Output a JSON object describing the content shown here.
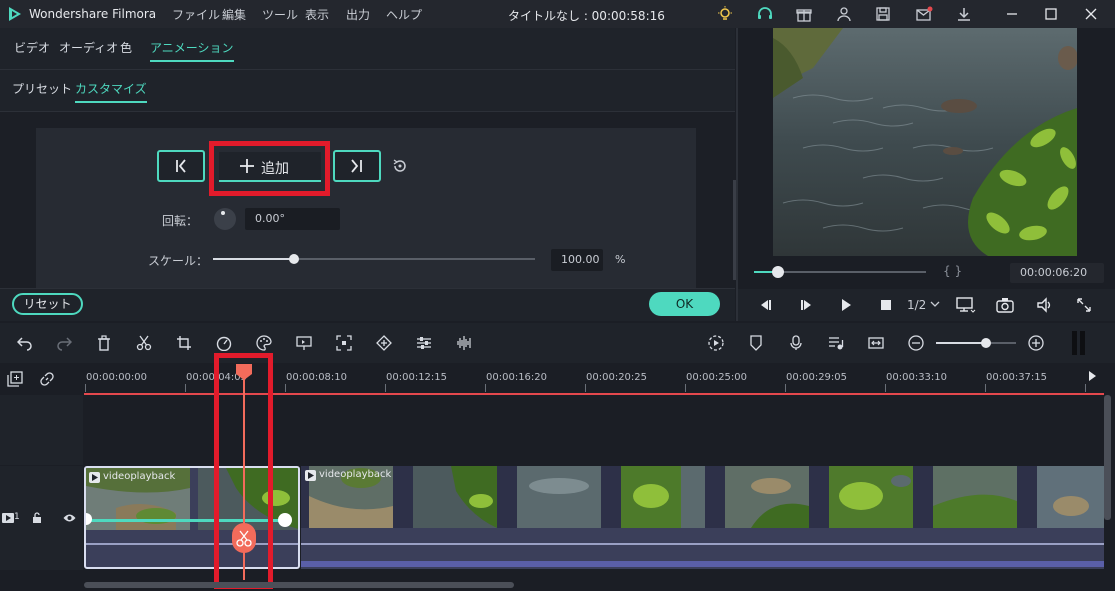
{
  "app": {
    "name": "Wondershare Filmora",
    "window_title": "タイトルなし : 00:00:58:16"
  },
  "menu": {
    "items": [
      "ファイル",
      "編集",
      "ツール",
      "表示",
      "出力",
      "ヘルプ"
    ]
  },
  "edit_tabs": {
    "items": [
      "ビデオ",
      "オーディオ",
      "色",
      "アニメーション"
    ],
    "active": "アニメーション"
  },
  "sub_tabs": {
    "items": [
      "プリセット",
      "カスタマイズ"
    ],
    "active": "カスタマイズ"
  },
  "keyframe": {
    "add_label": "追加"
  },
  "rotation": {
    "label": "回転：",
    "value": "0.00°"
  },
  "scale": {
    "label": "スケール：",
    "value": "100.00",
    "unit": "%",
    "slider_fraction": 0.25
  },
  "buttons": {
    "reset": "リセット",
    "ok": "OK"
  },
  "preview": {
    "timecode": "00:00:06:20",
    "quality": "1/2",
    "progress_fraction": 0.14,
    "brackets": "{   }"
  },
  "timeline": {
    "ruler": [
      "00:00:00:00",
      "00:00:04:05",
      "00:00:08:10",
      "00:00:12:15",
      "00:00:16:20",
      "00:00:20:25",
      "00:00:25:00",
      "00:00:29:05",
      "00:00:33:10",
      "00:00:37:15"
    ],
    "clips": [
      "videoplayback",
      "videoplayback"
    ],
    "track_number": "1",
    "zoom_fraction": 0.62
  },
  "colors": {
    "accent": "#4ed9bf",
    "highlight": "#e21b2b",
    "playhead": "#f26b5b",
    "clip_bg": "#3b3f5a"
  }
}
